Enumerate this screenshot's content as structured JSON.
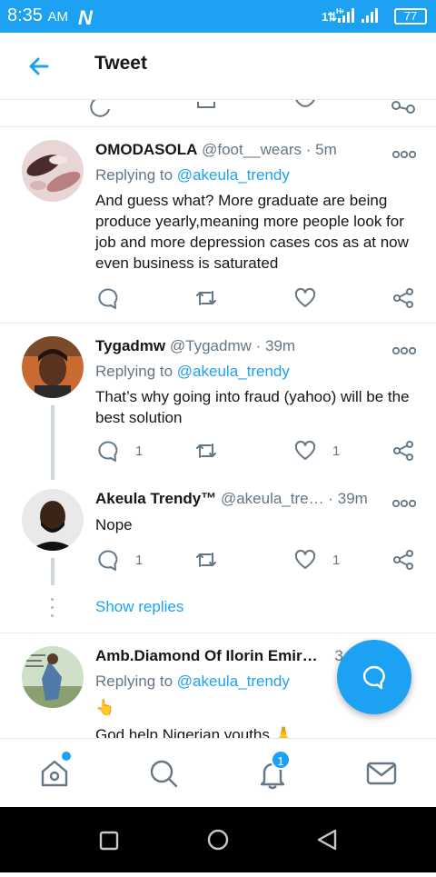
{
  "status_bar": {
    "time": "8:35",
    "ampm": "AM",
    "network": "1⇅ H+ .ıl .ıl",
    "battery": "77"
  },
  "app_bar": {
    "title": "Tweet"
  },
  "tweets": [
    {
      "name": "OMODASOLA",
      "handle": "@foot__wears",
      "time": "5m",
      "replying_label": "Replying to",
      "replying_handle": "@akeula_trendy",
      "text": "And guess what? More graduate are being produce yearly,meaning more people look for job and more depression cases cos as at now even business is saturated",
      "reply_count": "",
      "like_count": ""
    },
    {
      "name": "Tygadmw",
      "handle": "@Tygadmw",
      "time": "39m",
      "replying_label": "Replying to",
      "replying_handle": "@akeula_trendy",
      "text": "That’s why going into fraud (yahoo) will be the best solution",
      "reply_count": "1",
      "like_count": "1"
    },
    {
      "name": "Akeula Trendy™",
      "handle": "@akeula_tre…",
      "time": "39m",
      "text": "Nope",
      "reply_count": "1",
      "like_count": "1"
    },
    {
      "name": "Amb.Diamond Of Ilorin Emir…",
      "handle": "",
      "time": "3",
      "replying_label": "Replying to",
      "replying_handle": "@akeula_trendy",
      "emoji_line": "👆",
      "text": "God help Nigerian youths 🙏"
    }
  ],
  "thread": {
    "show_replies": "Show replies"
  },
  "bottom_nav": {
    "notifications_badge": "1"
  },
  "colors": {
    "accent": "#1da1f2",
    "text": "#14171a",
    "muted": "#657786"
  }
}
